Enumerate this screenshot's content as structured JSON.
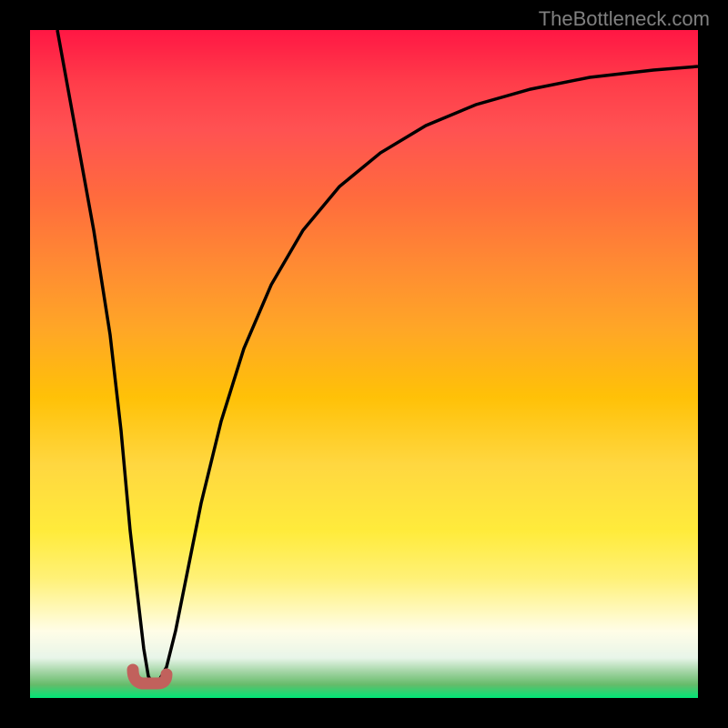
{
  "watermark": "TheBottleneck.com",
  "chart_data": {
    "type": "line",
    "title": "",
    "xlabel": "",
    "ylabel": "",
    "x_range": [
      0,
      100
    ],
    "y_range": [
      0,
      100
    ],
    "series": [
      {
        "name": "bottleneck-curve-left",
        "x": [
          4,
          6,
          8,
          10,
          12,
          13.5,
          14.5,
          15.5,
          16.5
        ],
        "y": [
          100,
          85,
          70,
          55,
          40,
          25,
          15,
          8,
          3
        ]
      },
      {
        "name": "bottleneck-curve-right",
        "x": [
          20,
          22,
          24,
          27,
          30,
          34,
          38,
          43,
          49,
          56,
          64,
          73,
          83,
          94,
          100
        ],
        "y": [
          3,
          10,
          20,
          32,
          43,
          53,
          61,
          68,
          74,
          79,
          83,
          86.5,
          89,
          91,
          92
        ]
      },
      {
        "name": "marker",
        "x": [
          16,
          18.5
        ],
        "y": [
          2.5,
          2
        ]
      }
    ],
    "gradient_colors": {
      "top": "#ff1744",
      "middle": "#ffc107",
      "bottom": "#00e676"
    },
    "marker_color": "#c1615c"
  }
}
